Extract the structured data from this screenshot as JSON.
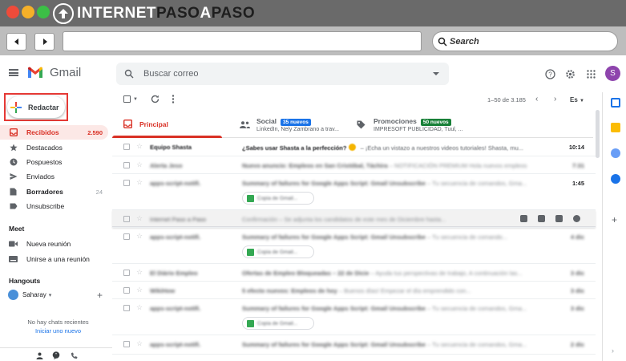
{
  "site": {
    "brand_part1": "INTERNET",
    "brand_part2": "PASO",
    "brand_part3": "A",
    "brand_part4": "PASO",
    "search_placeholder": "Search"
  },
  "gmail": {
    "app_name": "Gmail",
    "search_placeholder": "Buscar correo",
    "avatar_letter": "S",
    "compose_label": "Redactar"
  },
  "sidebar": {
    "items": [
      {
        "label": "Recibidos",
        "count": "2.590",
        "icon": "inbox-icon"
      },
      {
        "label": "Destacados",
        "count": "",
        "icon": "star-icon"
      },
      {
        "label": "Pospuestos",
        "count": "",
        "icon": "clock-icon"
      },
      {
        "label": "Enviados",
        "count": "",
        "icon": "send-icon"
      },
      {
        "label": "Borradores",
        "count": "24",
        "icon": "draft-icon"
      },
      {
        "label": "Unsubscribe",
        "count": "",
        "icon": "label-icon"
      }
    ],
    "meet_title": "Meet",
    "meet_items": [
      {
        "label": "Nueva reunión",
        "icon": "video-icon"
      },
      {
        "label": "Unirse a una reunión",
        "icon": "keyboard-icon"
      }
    ],
    "hangouts_title": "Hangouts",
    "hangouts_user": "Saharay",
    "no_chats": "No hay chats recientes",
    "start_new": "Iniciar uno nuevo"
  },
  "toolbar": {
    "range": "1–50 de 3.185",
    "lang": "Es"
  },
  "tabs": [
    {
      "label": "Principal",
      "badge": "",
      "sub": ""
    },
    {
      "label": "Social",
      "badge": "35 nuevos",
      "sub": "LinkedIn, Nely Zambrano a trav..."
    },
    {
      "label": "Promociones",
      "badge": "50 nuevos",
      "sub": "IMPRESOFT PUBLICIDAD, Tuul, ..."
    }
  ],
  "emails": [
    {
      "from": "Equipo Shasta",
      "subject": "¿Sabes usar Shasta a la perfección?",
      "snippet": " – ¡Echa un vistazo a nuestros videos tutoriales! Shasta, mu...",
      "time": "10:14"
    },
    {
      "from": "Alerta Jeso",
      "subject": "Nuevo anuncio: Empleos en San Cristóbal, Táchira",
      "snippet": " – NOTIFICACIÓN PREMIUM Hola nuevos empleos",
      "time": "7:31"
    },
    {
      "from": "apps-script-notifi.",
      "subject": "Summary of failures for Google Apps Script: Gmail Unsubscribe",
      "snippet": " – Tu secuencia de comandos, Gma...",
      "time": "1:45",
      "chip": "Copia de Gmail..."
    },
    {
      "from": "Internet Paso a Paso",
      "subject": "Confirmación",
      "snippet": " – Se adjunta los candidatos de este mes de Diciembre hasta...",
      "time": ""
    },
    {
      "from": "apps-script-notifi.",
      "subject": "Summary of failures for Google Apps Script: Gmail Unsubscribe",
      "snippet": " – Tu secuencia de comando...",
      "time": "4 dic",
      "chip": "Copia de Gmail..."
    },
    {
      "from": "El Diário Empleo",
      "subject": "Ofertas de Empleo Bloqueadas – 22 de Dicie",
      "snippet": " – Ayuda tus perspectivas de trabajo, A continuación las...",
      "time": "3 dic"
    },
    {
      "from": "WikiHow",
      "subject": "5 efecto nuevos: Empleos de hoy",
      "snippet": " – Buenos días! Empezar el día emprendido con...",
      "time": "3 dic"
    },
    {
      "from": "apps-script-notifi.",
      "subject": "Summary of failures for Google Apps Script: Gmail Unsubscribe",
      "snippet": " – Tu secuencia de comandos, Gma...",
      "time": "3 dic",
      "chip": "Copia de Gmail..."
    },
    {
      "from": "apps-script-notifi.",
      "subject": "Summary of failures for Google Apps Script: Gmail Unsubscribe",
      "snippet": " – Tu secuencia de comandos, Gma...",
      "time": "2 dic"
    }
  ],
  "colors": {
    "accent_red": "#d93025",
    "social_badge": "#1a73e8",
    "promo_badge": "#188038",
    "brand_highlight": "#e53935"
  }
}
